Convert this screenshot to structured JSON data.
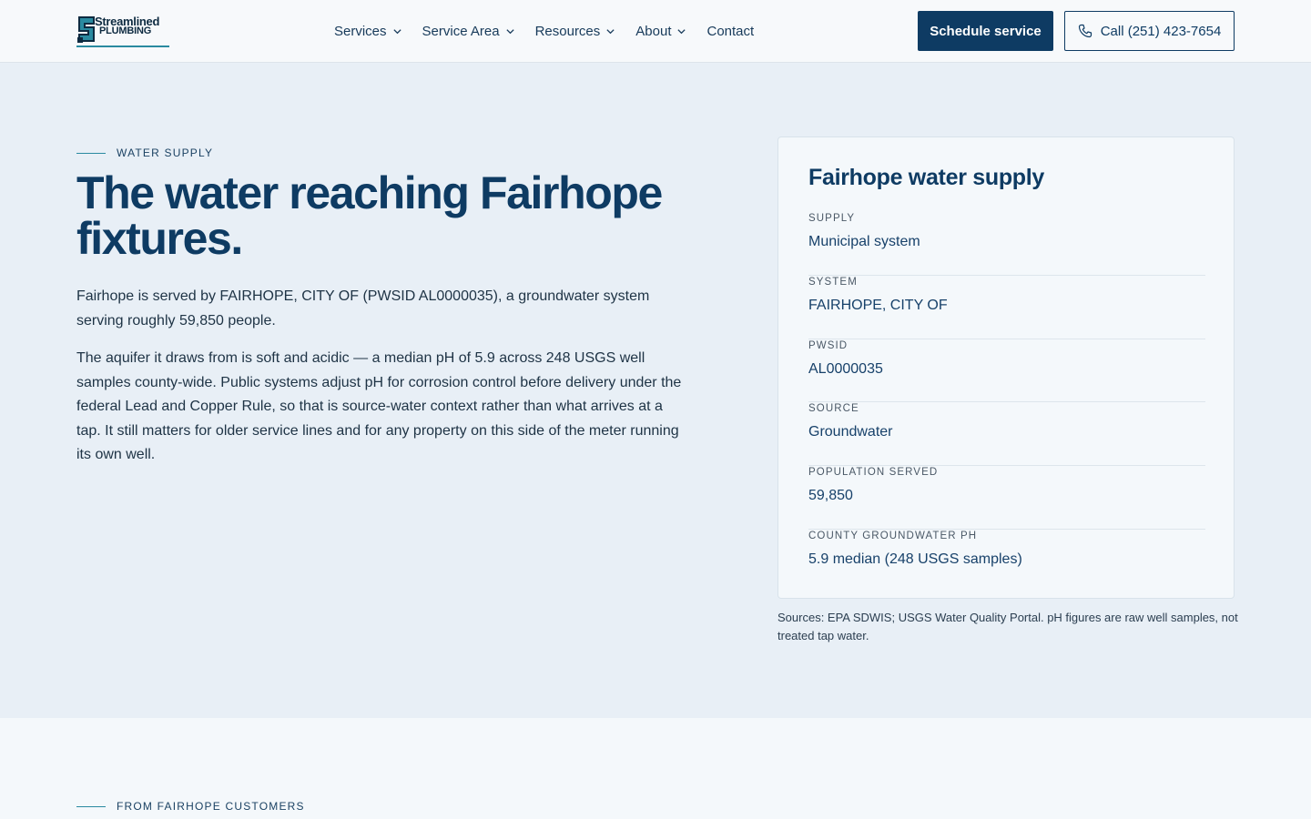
{
  "brand": {
    "name_line1": "Streamlined",
    "name_line2": "PLUMBING",
    "accent": "#2a8aa0",
    "primary": "#0e3b63"
  },
  "nav": {
    "items": [
      {
        "label": "Services",
        "has_dropdown": true
      },
      {
        "label": "Service Area",
        "has_dropdown": true
      },
      {
        "label": "Resources",
        "has_dropdown": true
      },
      {
        "label": "About",
        "has_dropdown": true
      },
      {
        "label": "Contact",
        "has_dropdown": false
      }
    ]
  },
  "header": {
    "cta_primary": "Schedule service",
    "cta_phone": "Call (251) 423-7654",
    "phone_icon": "phone-icon"
  },
  "hero": {
    "eyebrow": "WATER SUPPLY",
    "title": "The water reaching Fairhope fixtures.",
    "paragraph1": "Fairhope is served by FAIRHOPE, CITY OF (PWSID AL0000035), a groundwater system serving roughly 59,850 people.",
    "paragraph2": "The aquifer it draws from is soft and acidic — a median pH of 5.9 across 248 USGS well samples county-wide. Public systems adjust pH for corrosion control before delivery under the federal Lead and Copper Rule, so that is source-water context rather than what arrives at a tap. It still matters for older service lines and for any property on this side of the meter running its own well."
  },
  "card": {
    "title": "Fairhope water supply",
    "rows": [
      {
        "label": "SUPPLY",
        "value": "Municipal system"
      },
      {
        "label": "SYSTEM",
        "value": "FAIRHOPE, CITY OF"
      },
      {
        "label": "PWSID",
        "value": "AL0000035"
      },
      {
        "label": "SOURCE",
        "value": "Groundwater"
      },
      {
        "label": "POPULATION SERVED",
        "value": "59,850"
      },
      {
        "label": "COUNTY GROUNDWATER PH",
        "value": "5.9 median (248 USGS samples)"
      }
    ],
    "sources": "Sources: EPA SDWIS; USGS Water Quality Portal. pH figures are raw well samples, not treated tap water."
  },
  "lower": {
    "eyebrow": "FROM FAIRHOPE CUSTOMERS"
  }
}
